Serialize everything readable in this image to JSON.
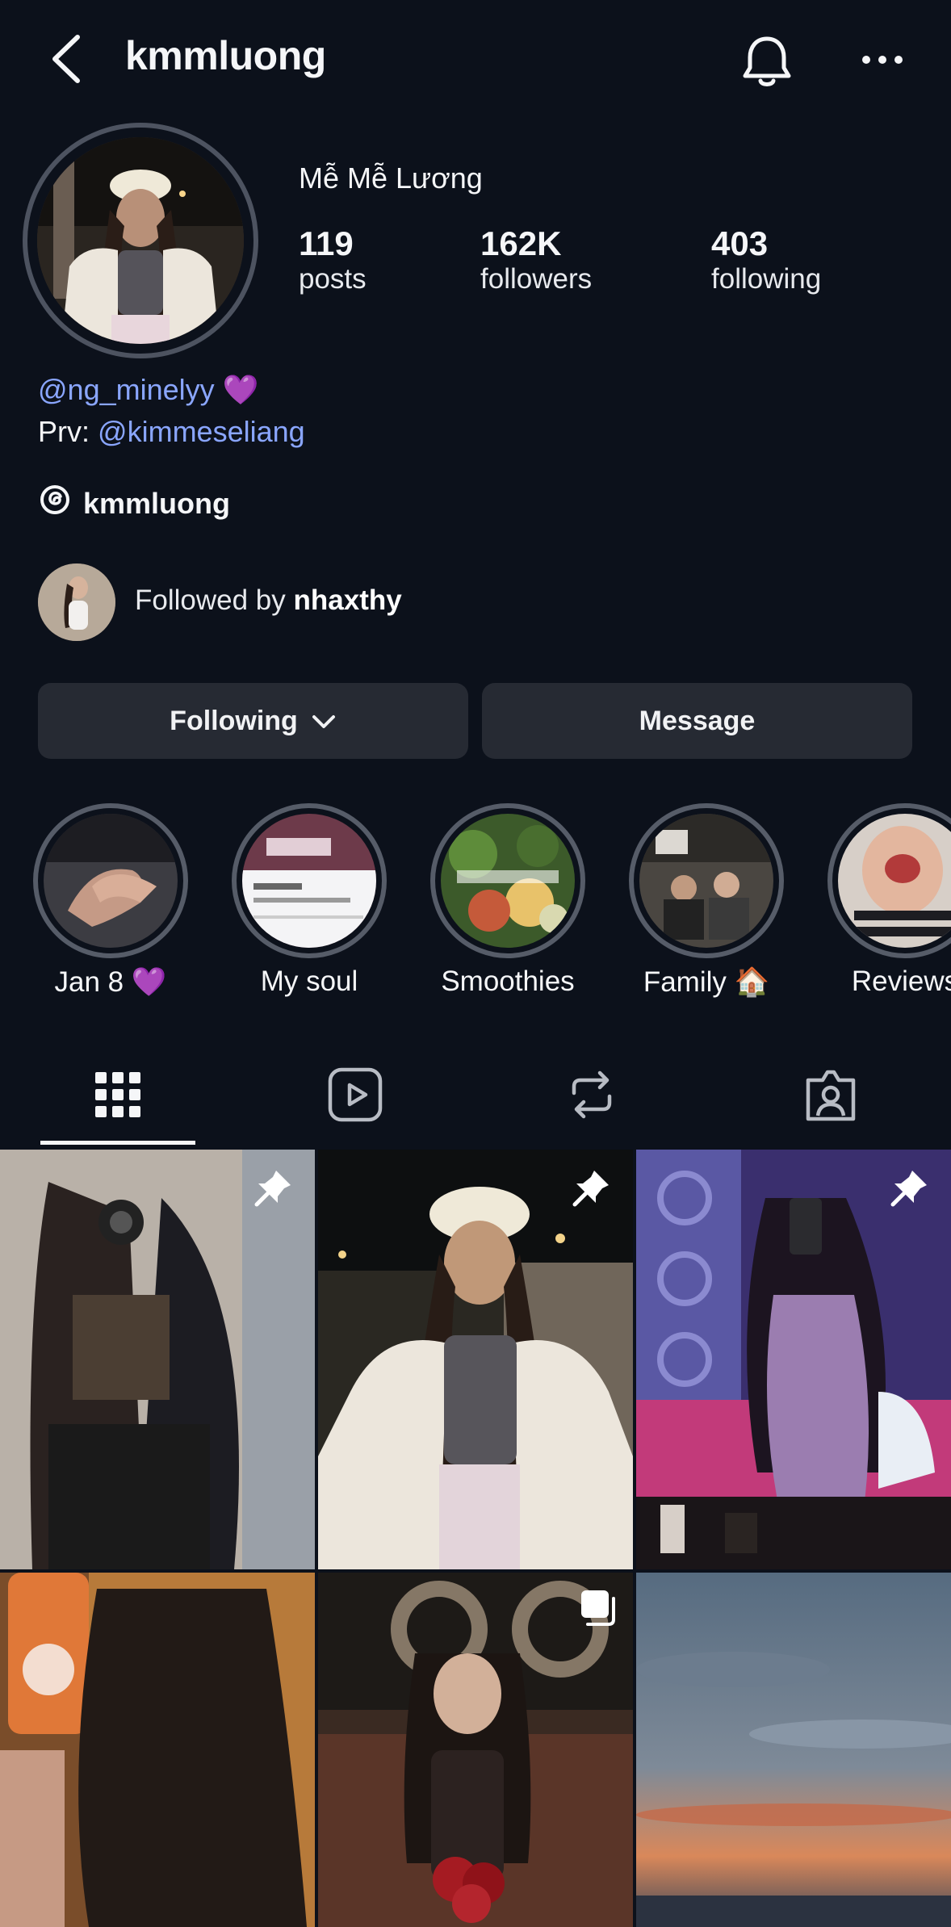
{
  "header": {
    "username": "kmmluong"
  },
  "profile": {
    "full_name": "Mễ Mễ Lương",
    "stats": [
      {
        "value": "119",
        "label": "posts"
      },
      {
        "value": "162K",
        "label": "followers"
      },
      {
        "value": "403",
        "label": "following"
      }
    ],
    "bio_line1_link": "@ng_minelyy",
    "bio_line1_emoji": "💜",
    "bio_line2_prefix": "Prv:",
    "bio_line2_link": "@kimmeseliang",
    "threads_handle": "kmmluong",
    "followed_by_prefix": "Followed by",
    "followed_by_name": "nhaxthy"
  },
  "buttons": {
    "following": "Following",
    "message": "Message"
  },
  "highlights": [
    {
      "label": "Jan 8 💜"
    },
    {
      "label": "My soul"
    },
    {
      "label": "Smoothies"
    },
    {
      "label": "Family 🏠"
    },
    {
      "label": "Reviews"
    }
  ],
  "tabs": [
    "posts-grid",
    "reels",
    "reposts",
    "tagged"
  ],
  "colors": {
    "background": "#0c111b",
    "link": "#8aa6ff",
    "button": "#262a33",
    "ring": "#565c68"
  }
}
